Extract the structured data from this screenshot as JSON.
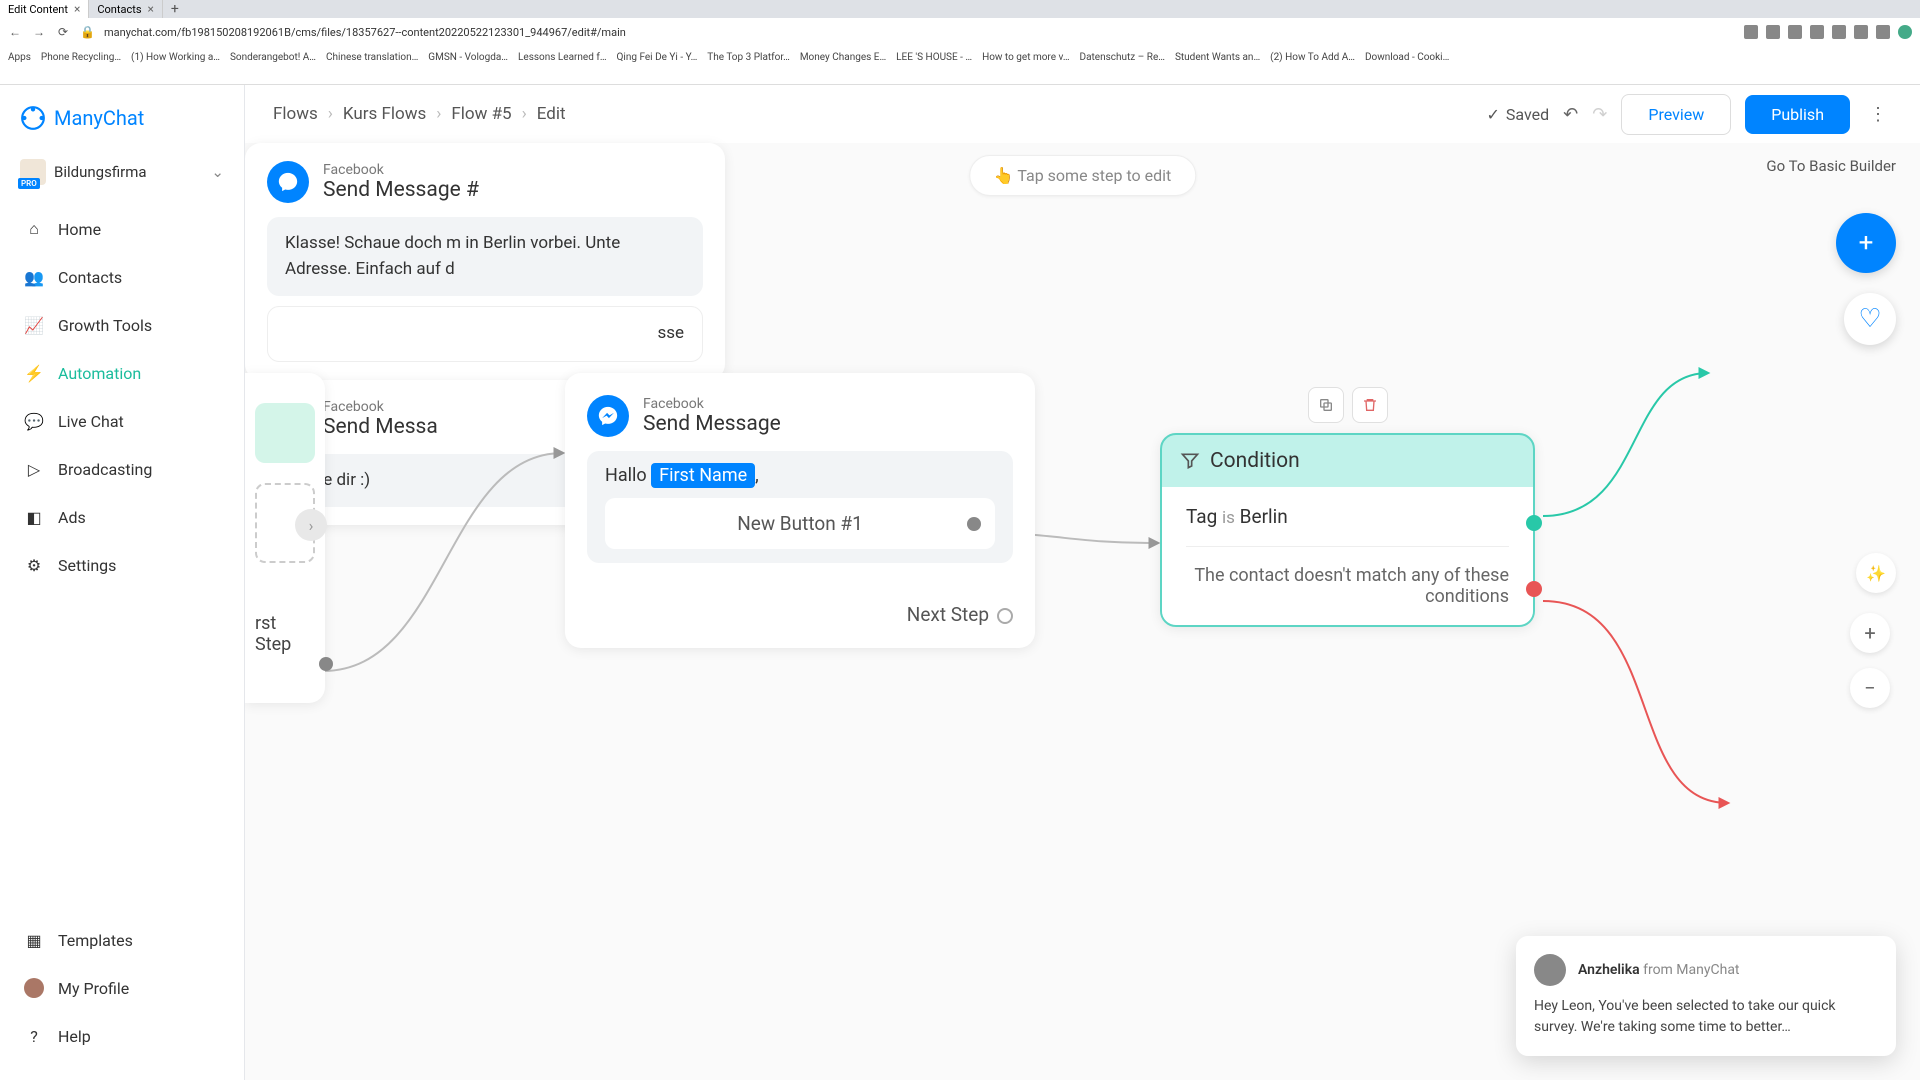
{
  "browser": {
    "tabs": [
      {
        "title": "Edit Content",
        "active": true
      },
      {
        "title": "Contacts",
        "active": false
      }
    ],
    "url": "manychat.com/fb198150208192061B/cms/files/18357627--content20220522123301_944967/edit#/main",
    "bookmarks": [
      "Apps",
      "Phone Recycling…",
      "(1) How Working a…",
      "Sonderangebot! A…",
      "Chinese translation…",
      "GMSN - Vologda…",
      "Lessons Learned f…",
      "Qing Fei De Yi - Y…",
      "The Top 3 Platfor…",
      "Money Changes E…",
      "LEE 'S HOUSE - …",
      "How to get more v…",
      "Datenschutz – Re…",
      "Student Wants an…",
      "(2) How To Add A…",
      "Download - Cooki…"
    ]
  },
  "app": {
    "brand": "ManyChat",
    "workspace": {
      "name": "Bildungsfirma",
      "badge": "PRO"
    },
    "nav": {
      "home": "Home",
      "contacts": "Contacts",
      "growth": "Growth Tools",
      "automation": "Automation",
      "livechat": "Live Chat",
      "broadcasting": "Broadcasting",
      "ads": "Ads",
      "settings": "Settings",
      "templates": "Templates",
      "profile": "My Profile",
      "help": "Help"
    },
    "breadcrumbs": [
      "Flows",
      "Kurs Flows",
      "Flow #5",
      "Edit"
    ],
    "topbar": {
      "saved": "Saved",
      "preview": "Preview",
      "publish": "Publish"
    },
    "canvas": {
      "hint": "Tap some step to edit",
      "basic_builder": "Go To Basic Builder",
      "start_label": "rst Step",
      "msg": {
        "platform": "Facebook",
        "title": "Send Message",
        "greeting_prefix": "Hallo ",
        "greeting_tag": "First Name",
        "greeting_suffix": ",",
        "button": "New Button #1",
        "next": "Next Step"
      },
      "condition": {
        "title": "Condition",
        "rule_field": "Tag",
        "rule_op": "is",
        "rule_value": "Berlin",
        "nomatch": "The contact doesn't match any of these conditions"
      },
      "out_top": {
        "platform": "Facebook",
        "title": "Send Message #",
        "body": "Klasse! Schaue doch m in Berlin vorbei. Unte Adresse. Einfach auf d",
        "extra": "sse"
      },
      "out_bot": {
        "platform": "Facebook",
        "title": "Send Messa",
        "body": "Danke dir :)"
      }
    },
    "chat": {
      "name": "Anzhelika",
      "from": "from ManyChat",
      "body": "Hey Leon,  You've been selected to take our quick survey. We're taking some time to better…"
    }
  }
}
